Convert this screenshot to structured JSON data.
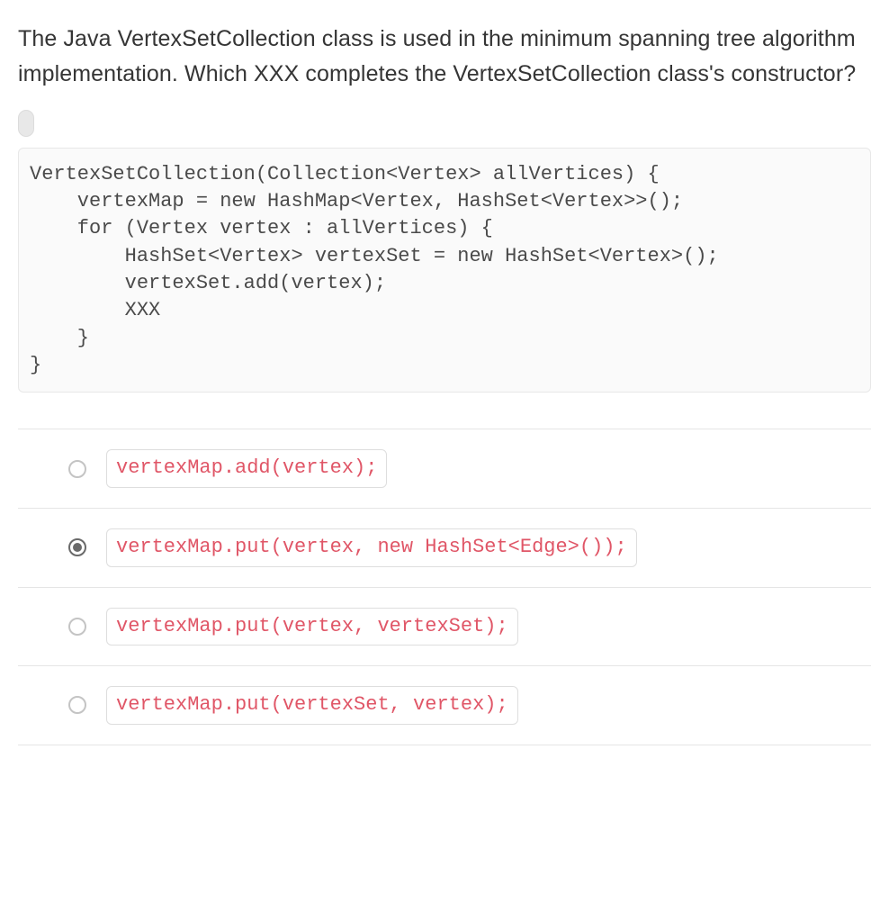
{
  "question": "The Java VertexSetCollection class is used in the minimum spanning tree algorithm implementation. Which XXX completes the VertexSetCollection class's constructor?",
  "code": "VertexSetCollection(Collection<Vertex> allVertices) {\n    vertexMap = new HashMap<Vertex, HashSet<Vertex>>();\n    for (Vertex vertex : allVertices) {\n        HashSet<Vertex> vertexSet = new HashSet<Vertex>();\n        vertexSet.add(vertex);\n        XXX\n    }\n}",
  "options": [
    {
      "label": "vertexMap.add(vertex);",
      "selected": false
    },
    {
      "label": "vertexMap.put(vertex, new HashSet<Edge>());",
      "selected": true
    },
    {
      "label": "vertexMap.put(vertex, vertexSet);",
      "selected": false
    },
    {
      "label": "vertexMap.put(vertexSet, vertex);",
      "selected": false
    }
  ]
}
